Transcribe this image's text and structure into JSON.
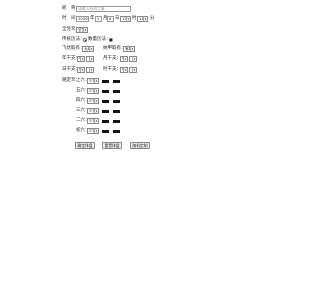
{
  "form": {
    "name_label": "昵　称：",
    "name_placeholder": "请输入所测之事",
    "time_label": "时　间：",
    "year_value": "2026",
    "year_unit": "年",
    "month_value": "1",
    "month_unit": "月",
    "day_value": "6",
    "day_unit": "日",
    "hour_value": "15",
    "hour_unit": "时",
    "minute_value": "11",
    "minute_unit": "分",
    "gender_label": "全凭爻：",
    "gender_value": "全凭",
    "mode_label": "传统历法：",
    "mode_option_label": "数量历法：",
    "mode_option_value": "■",
    "fly_label": "飞伏取有：",
    "fly_value": "无取",
    "nayin_label": "纳甲取有：",
    "nayin_value": "有取",
    "year_gz_label": "年干支：",
    "year_gz_value": "甲",
    "month_gz_label": "月干支：",
    "month_gz_value": "甲",
    "day_gz_label": "日干支：",
    "day_gz_value": "甲",
    "hour_gz_label": "时干支：",
    "hour_gz_value": "甲",
    "yao_label": "随定爻：",
    "yao_rows": [
      {
        "label": "上六：",
        "value": "少阴"
      },
      {
        "label": "五六：",
        "value": "少阴"
      },
      {
        "label": "四六：",
        "value": "少阴"
      },
      {
        "label": "三六：",
        "value": "少阴"
      },
      {
        "label": "二六：",
        "value": "少阴"
      },
      {
        "label": "初六：",
        "value": "少阴"
      }
    ],
    "buttons": {
      "submit": "确定排盘",
      "reset": "重置排盘",
      "custom": "随机定制"
    }
  }
}
